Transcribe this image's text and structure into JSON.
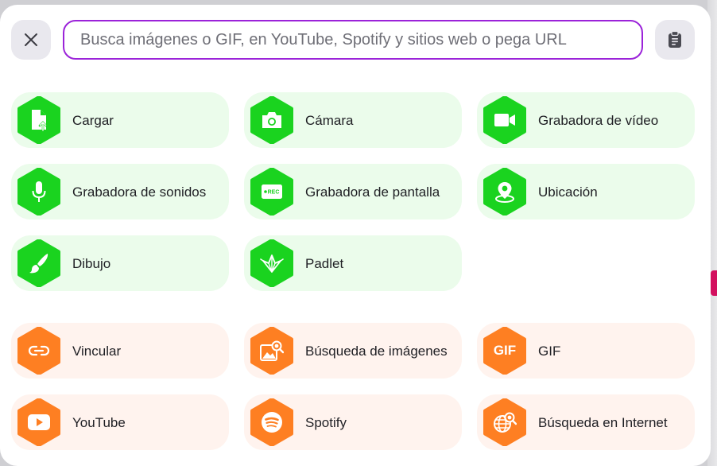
{
  "search": {
    "placeholder": "Busca imágenes o GIF, en YouTube, Spotify y sitios web o pega URL"
  },
  "colors": {
    "accent_border": "#9b23d9",
    "green_hex": "#1ad31f",
    "green_tile": "#ebfceb",
    "orange_hex": "#fe7f22",
    "orange_tile": "#fff3ee"
  },
  "tiles": [
    {
      "label": "Cargar",
      "icon": "upload-file-icon"
    },
    {
      "label": "Cámara",
      "icon": "camera-icon"
    },
    {
      "label": "Grabadora de vídeo",
      "icon": "video-camera-icon"
    },
    {
      "label": "Grabadora de sonidos",
      "icon": "microphone-icon"
    },
    {
      "label": "Grabadora de pantalla",
      "icon": "screen-record-icon"
    },
    {
      "label": "Ubicación",
      "icon": "location-pin-icon"
    },
    {
      "label": "Dibujo",
      "icon": "paintbrush-icon"
    },
    {
      "label": "Padlet",
      "icon": "padlet-bird-icon"
    },
    {
      "label": "Vincular",
      "icon": "link-icon"
    },
    {
      "label": "Búsqueda de imágenes",
      "icon": "image-search-icon"
    },
    {
      "label": "GIF",
      "icon": "gif-icon",
      "glyph_text": "GIF"
    },
    {
      "label": "YouTube",
      "icon": "youtube-icon"
    },
    {
      "label": "Spotify",
      "icon": "spotify-icon"
    },
    {
      "label": "Búsqueda en Internet",
      "icon": "web-search-icon"
    }
  ],
  "screen_record_badge": "REC"
}
